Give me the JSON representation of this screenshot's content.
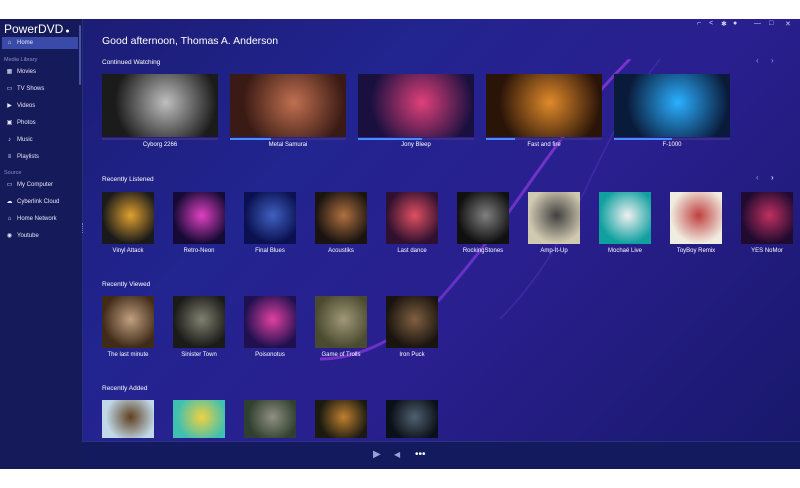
{
  "app": {
    "title": "PowerDVD",
    "title_menu_icon": "drop-icon"
  },
  "sidebar": {
    "home": "Home",
    "media_library_label": "Media Library",
    "media_items": [
      {
        "label": "Movies",
        "icon": "film-icon"
      },
      {
        "label": "TV Shows",
        "icon": "tv-icon"
      },
      {
        "label": "Videos",
        "icon": "video-icon"
      },
      {
        "label": "Photos",
        "icon": "photo-icon"
      },
      {
        "label": "Music",
        "icon": "music-icon"
      },
      {
        "label": "Playlists",
        "icon": "playlist-icon"
      }
    ],
    "source_label": "Source",
    "source_items": [
      {
        "label": "My Computer",
        "icon": "computer-icon"
      },
      {
        "label": "Cyberlink Cloud",
        "icon": "cloud-icon"
      },
      {
        "label": "Home Network",
        "icon": "network-icon"
      },
      {
        "label": "Youtube",
        "icon": "youtube-icon"
      }
    ]
  },
  "greeting": "Good afternoon, Thomas A. Anderson",
  "sections": {
    "continued": {
      "title": "Continued Watching",
      "items": [
        {
          "title": "Cyborg 2266",
          "progress": 0.0,
          "colors": [
            "#1b1b1b",
            "#bfbfbf"
          ]
        },
        {
          "title": "Metal Samurai",
          "progress": 0.35,
          "colors": [
            "#3a1a14",
            "#c07050"
          ]
        },
        {
          "title": "Jony Bleep",
          "progress": 0.55,
          "colors": [
            "#1a1040",
            "#e0407a"
          ]
        },
        {
          "title": "Fast and fire",
          "progress": 0.25,
          "colors": [
            "#2a1408",
            "#e08a2a"
          ]
        },
        {
          "title": "F-1000",
          "progress": 0.5,
          "colors": [
            "#0a1a3a",
            "#2ab0ff"
          ]
        }
      ]
    },
    "listened": {
      "title": "Recently Listened",
      "items": [
        {
          "title": "Vinyl Attack",
          "colors": [
            "#1a1a1a",
            "#e0a030"
          ]
        },
        {
          "title": "Retro-Neon",
          "colors": [
            "#150a35",
            "#e040c0"
          ]
        },
        {
          "title": "Final Blues",
          "colors": [
            "#0a1050",
            "#4060c0"
          ]
        },
        {
          "title": "Acoustiks",
          "colors": [
            "#1a1410",
            "#b07040"
          ]
        },
        {
          "title": "Last dance",
          "colors": [
            "#301030",
            "#e05060"
          ]
        },
        {
          "title": "RockingStones",
          "colors": [
            "#101010",
            "#808080"
          ]
        },
        {
          "title": "Amp-It-Up",
          "colors": [
            "#d0c8b0",
            "#404040"
          ]
        },
        {
          "title": "Mochaé Live",
          "colors": [
            "#10a0a0",
            "#f0f0f0"
          ]
        },
        {
          "title": "ToyBoy Remix",
          "colors": [
            "#f0ece0",
            "#c04040"
          ]
        },
        {
          "title": "YES NoMor",
          "colors": [
            "#200a30",
            "#c03060"
          ]
        }
      ]
    },
    "viewed": {
      "title": "Recently Viewed",
      "items": [
        {
          "title": "The last minute",
          "colors": [
            "#402a18",
            "#c0a080"
          ]
        },
        {
          "title": "Sinister Town",
          "colors": [
            "#1a1a18",
            "#808070"
          ]
        },
        {
          "title": "Poisonotus",
          "colors": [
            "#201050",
            "#e040a0"
          ]
        },
        {
          "title": "Game of Trolls",
          "colors": [
            "#4a4a30",
            "#a09878"
          ]
        },
        {
          "title": "Iron Puck",
          "colors": [
            "#1a1410",
            "#806040"
          ]
        }
      ]
    },
    "added": {
      "title": "Recently Added",
      "items": [
        {
          "colors": [
            "#c0d8e8",
            "#604020"
          ]
        },
        {
          "colors": [
            "#40c0b0",
            "#f0d040"
          ]
        },
        {
          "colors": [
            "#304030",
            "#909080"
          ]
        },
        {
          "colors": [
            "#1a1a10",
            "#c08030"
          ]
        },
        {
          "colors": [
            "#0a1018",
            "#506070"
          ]
        }
      ]
    }
  },
  "playback": {
    "play_icon": "play-icon",
    "volume_icon": "volume-icon",
    "more_icon": "more-icon"
  }
}
